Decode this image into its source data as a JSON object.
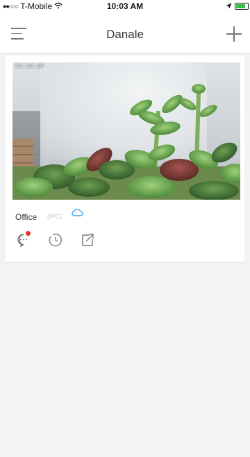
{
  "status_bar": {
    "carrier": "T-Mobile",
    "time": "10:03 AM",
    "battery_level": 0.8,
    "colors": {
      "battery": "#39c24b"
    }
  },
  "nav": {
    "title": "Danale",
    "menu_icon": "hamburger-menu-icon",
    "add_icon": "plus-icon"
  },
  "device": {
    "name": "Office",
    "type": "(IPC)",
    "cloud_icon": "cloud-icon",
    "timestamp_overlay": "E3:S3:EF",
    "has_alert": true,
    "actions": [
      {
        "icon": "message-icon"
      },
      {
        "icon": "history-clock-icon"
      },
      {
        "icon": "share-icon"
      }
    ],
    "colors": {
      "cloud": "#3aa8e8",
      "alert": "#e5322b"
    }
  }
}
